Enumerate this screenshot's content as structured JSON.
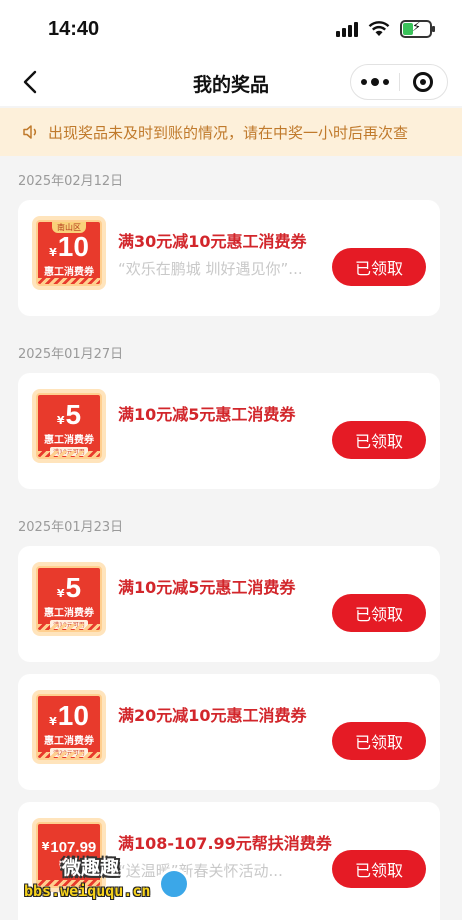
{
  "status_bar": {
    "time": "14:40"
  },
  "nav": {
    "title": "我的奖品"
  },
  "notice": {
    "text": "出现奖品未及时到账的情况，请在中奖一小时后再次查"
  },
  "sections": [
    {
      "date": "2025年02月12日",
      "items": [
        {
          "coupon": {
            "region": "南山区",
            "yen": "¥",
            "amount": "10",
            "type": "惠工消费券",
            "note": ""
          },
          "title": "满30元减10元惠工消费券",
          "subtitle": "“欢乐在鹏城 圳好遇见你”...",
          "button": "已领取"
        }
      ]
    },
    {
      "date": "2025年01月27日",
      "items": [
        {
          "coupon": {
            "region": "",
            "yen": "¥",
            "amount": "5",
            "type": "惠工消费券",
            "note": "满10元可用"
          },
          "title": "满10元减5元惠工消费券",
          "subtitle": "",
          "button": "已领取"
        }
      ]
    },
    {
      "date": "2025年01月23日",
      "items": [
        {
          "coupon": {
            "region": "",
            "yen": "¥",
            "amount": "5",
            "type": "惠工消费券",
            "note": "满10元可用"
          },
          "title": "满10元减5元惠工消费券",
          "subtitle": "",
          "button": "已领取"
        },
        {
          "coupon": {
            "region": "",
            "yen": "¥",
            "amount": "10",
            "type": "惠工消费券",
            "note": "满20元可用"
          },
          "title": "满20元减10元惠工消费券",
          "subtitle": "",
          "button": "已领取"
        },
        {
          "coupon": {
            "region": "",
            "yen": "¥",
            "amount": "107.99",
            "type": "帮扶",
            "note": ""
          },
          "title": "满108-107.99元帮扶消费券",
          "subtitle": "“送温暖”新春关怀活动...",
          "button": "已领取"
        }
      ]
    }
  ],
  "watermark": {
    "name": "微趣趣",
    "url": "bbs.weiququ.cn"
  },
  "colors": {
    "accent": "#e51b25",
    "notice_bg": "#fdf0da",
    "notice_text": "#c07a2c",
    "title_red": "#d2262b"
  }
}
